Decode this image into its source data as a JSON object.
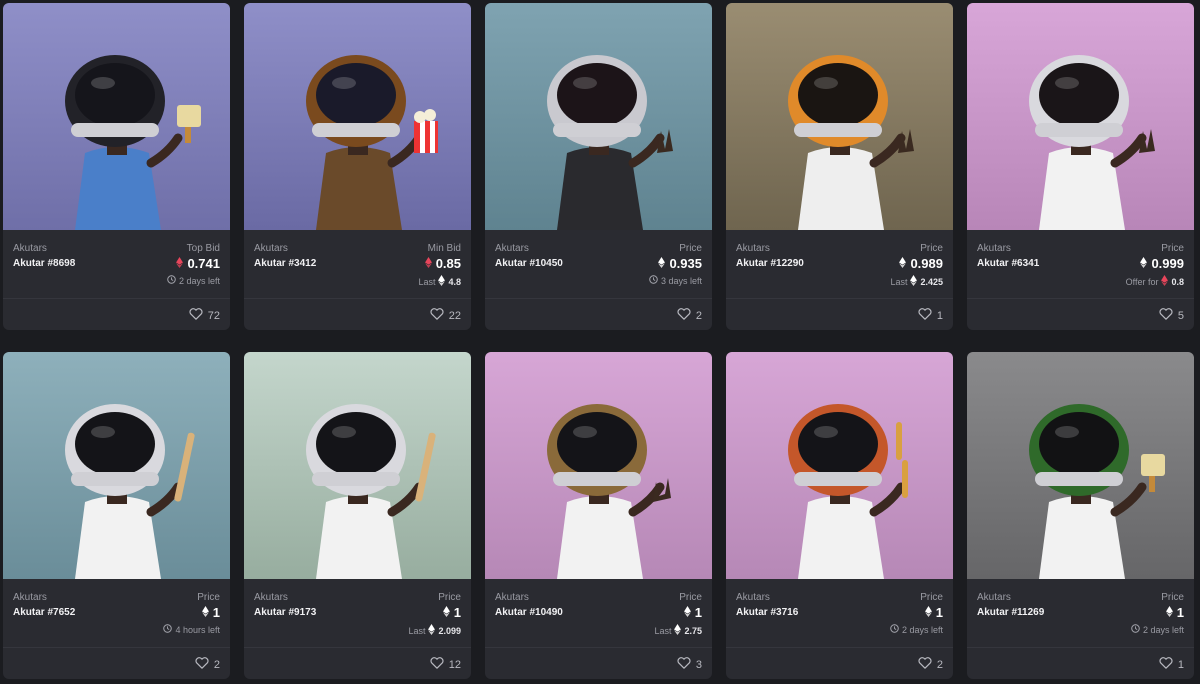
{
  "colors": {
    "page_bg": "#1b1c20",
    "card_bg": "#2a2b31",
    "eth_red": "#e8455b",
    "eth_white": "#ffffff"
  },
  "icons": {
    "currency": "ethereum-icon",
    "time": "clock-icon",
    "likes": "heart-icon"
  },
  "cards": [
    {
      "collection": "Akutars",
      "name": "Akutar #8698",
      "price_label": "Top Bid",
      "eth_color": "red",
      "price": "0.741",
      "sub": {
        "type": "time",
        "text": "2 days left"
      },
      "likes": "72",
      "art": {
        "bg_top": "#8f8fc8",
        "bg_bottom": "#6f6fa8",
        "helmet": "#222228",
        "visor": "#15151b",
        "shirt": "#4a7fc9",
        "item": "brush"
      }
    },
    {
      "collection": "Akutars",
      "name": "Akutar #3412",
      "price_label": "Min Bid",
      "eth_color": "red",
      "price": "0.85",
      "sub": {
        "type": "last",
        "label": "Last",
        "text": "4.8"
      },
      "likes": "22",
      "art": {
        "bg_top": "#8f8fc8",
        "bg_bottom": "#6a6aa4",
        "helmet": "#7a4a1e",
        "visor": "#1a1a2a",
        "shirt": "#6a4a2a",
        "item": "popcorn"
      }
    },
    {
      "collection": "Akutars",
      "name": "Akutar #10450",
      "price_label": "Price",
      "eth_color": "white",
      "price": "0.935",
      "sub": {
        "type": "time",
        "text": "3 days left"
      },
      "likes": "2",
      "art": {
        "bg_top": "#7fa3b1",
        "bg_bottom": "#5f8390",
        "helmet": "#c9c9cf",
        "visor": "#1c1418",
        "shirt": "#2a2a2e",
        "item": "peace"
      }
    },
    {
      "collection": "Akutars",
      "name": "Akutar #12290",
      "price_label": "Price",
      "eth_color": "white",
      "price": "0.989",
      "sub": {
        "type": "last",
        "label": "Last",
        "text": "2.425"
      },
      "likes": "1",
      "art": {
        "bg_top": "#9a8d72",
        "bg_bottom": "#6f654f",
        "helmet": "#e08a2a",
        "visor": "#1a1512",
        "shirt": "#eeeeee",
        "item": "peace"
      }
    },
    {
      "collection": "Akutars",
      "name": "Akutar #6341",
      "price_label": "Price",
      "eth_color": "white",
      "price": "0.999",
      "sub": {
        "type": "offer",
        "label": "Offer for",
        "text": "0.8"
      },
      "likes": "5",
      "art": {
        "bg_top": "#d8a6d8",
        "bg_bottom": "#b886b8",
        "helmet": "#d9d9de",
        "visor": "#1a1518",
        "shirt": "#f2f2f2",
        "item": "peace"
      }
    },
    {
      "collection": "Akutars",
      "name": "Akutar #7652",
      "price_label": "Price",
      "eth_color": "white",
      "price": "1",
      "sub": {
        "type": "time",
        "text": "4 hours left"
      },
      "likes": "2",
      "art": {
        "bg_top": "#8eb0bb",
        "bg_bottom": "#6a8d99",
        "helmet": "#d9d9de",
        "visor": "#141418",
        "shirt": "#f2f2f2",
        "item": "bat"
      }
    },
    {
      "collection": "Akutars",
      "name": "Akutar #9173",
      "price_label": "Price",
      "eth_color": "white",
      "price": "1",
      "sub": {
        "type": "last",
        "label": "Last",
        "text": "2.099"
      },
      "likes": "12",
      "art": {
        "bg_top": "#c4d6cc",
        "bg_bottom": "#97ad9f",
        "helmet": "#d9d9de",
        "visor": "#141418",
        "shirt": "#f2f2f2",
        "item": "bat"
      }
    },
    {
      "collection": "Akutars",
      "name": "Akutar #10490",
      "price_label": "Price",
      "eth_color": "white",
      "price": "1",
      "sub": {
        "type": "last",
        "label": "Last",
        "text": "2.75"
      },
      "likes": "3",
      "art": {
        "bg_top": "#d7a6d6",
        "bg_bottom": "#b688b6",
        "helmet": "#8a6a3a",
        "visor": "#141418",
        "shirt": "#f2f2f2",
        "item": "rock"
      }
    },
    {
      "collection": "Akutars",
      "name": "Akutar #3716",
      "price_label": "Price",
      "eth_color": "white",
      "price": "1",
      "sub": {
        "type": "time",
        "text": "2 days left"
      },
      "likes": "2",
      "art": {
        "bg_top": "#d7a6d6",
        "bg_bottom": "#b688b6",
        "helmet": "#c4572a",
        "visor": "#141418",
        "shirt": "#f2f2f2",
        "item": "nunchuck"
      }
    },
    {
      "collection": "Akutars",
      "name": "Akutar #11269",
      "price_label": "Price",
      "eth_color": "white",
      "price": "1",
      "sub": {
        "type": "time",
        "text": "2 days left"
      },
      "likes": "1",
      "art": {
        "bg_top": "#8a8a8c",
        "bg_bottom": "#666668",
        "helmet": "#2f6a2a",
        "visor": "#121214",
        "shirt": "#f2f2f2",
        "item": "brush"
      }
    }
  ]
}
